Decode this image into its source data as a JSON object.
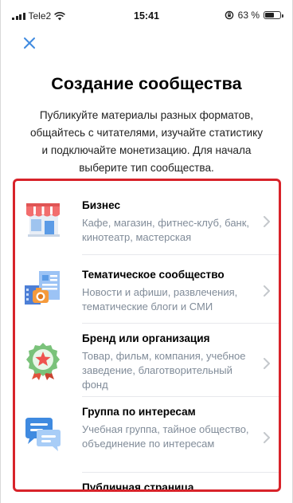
{
  "status_bar": {
    "carrier": "Tele2",
    "time": "15:41",
    "battery_percent": "63 %",
    "battery_level": 0.63
  },
  "header": {
    "close_icon": "close-icon",
    "title": "Создание сообщества",
    "subtitle": "Публикуйте материалы разных форматов, общайтесь с читателями, изучайте статистику и подключайте монетизацию. Для начала выберите тип сообщества."
  },
  "community_types": [
    {
      "name": "Бизнес",
      "description": "Кафе, магазин, фитнес-клуб, банк, кинотеатр, мастерская",
      "icon": "storefront-icon"
    },
    {
      "name": "Тематическое сообщество",
      "description": "Новости и афиши, развлечения, тематические блоги и СМИ",
      "icon": "camera-news-icon"
    },
    {
      "name": "Бренд или организация",
      "description": "Товар, фильм, компания, учебное заведение, благотворительный фонд",
      "icon": "star-badge-icon"
    },
    {
      "name": "Группа по интересам",
      "description": "Учебная группа, тайное общество, объединение по интересам",
      "icon": "chat-bubbles-icon"
    },
    {
      "name": "Публичная страница",
      "description": "",
      "icon": ""
    }
  ],
  "colors": {
    "accent": "#3f8ae0",
    "highlight_border": "#d8232a",
    "secondary_text": "#818c99"
  }
}
